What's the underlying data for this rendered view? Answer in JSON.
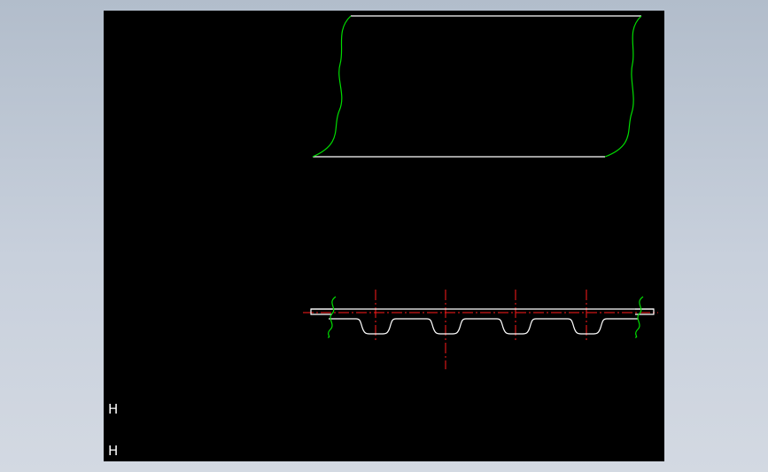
{
  "drawing": {
    "labels": [
      "H",
      "H"
    ],
    "colors": {
      "background": "#000000",
      "outline": "#ffffff",
      "break_line": "#00dd00",
      "center_line": "#ff1a1a",
      "frame": "#b8c2d0"
    }
  }
}
